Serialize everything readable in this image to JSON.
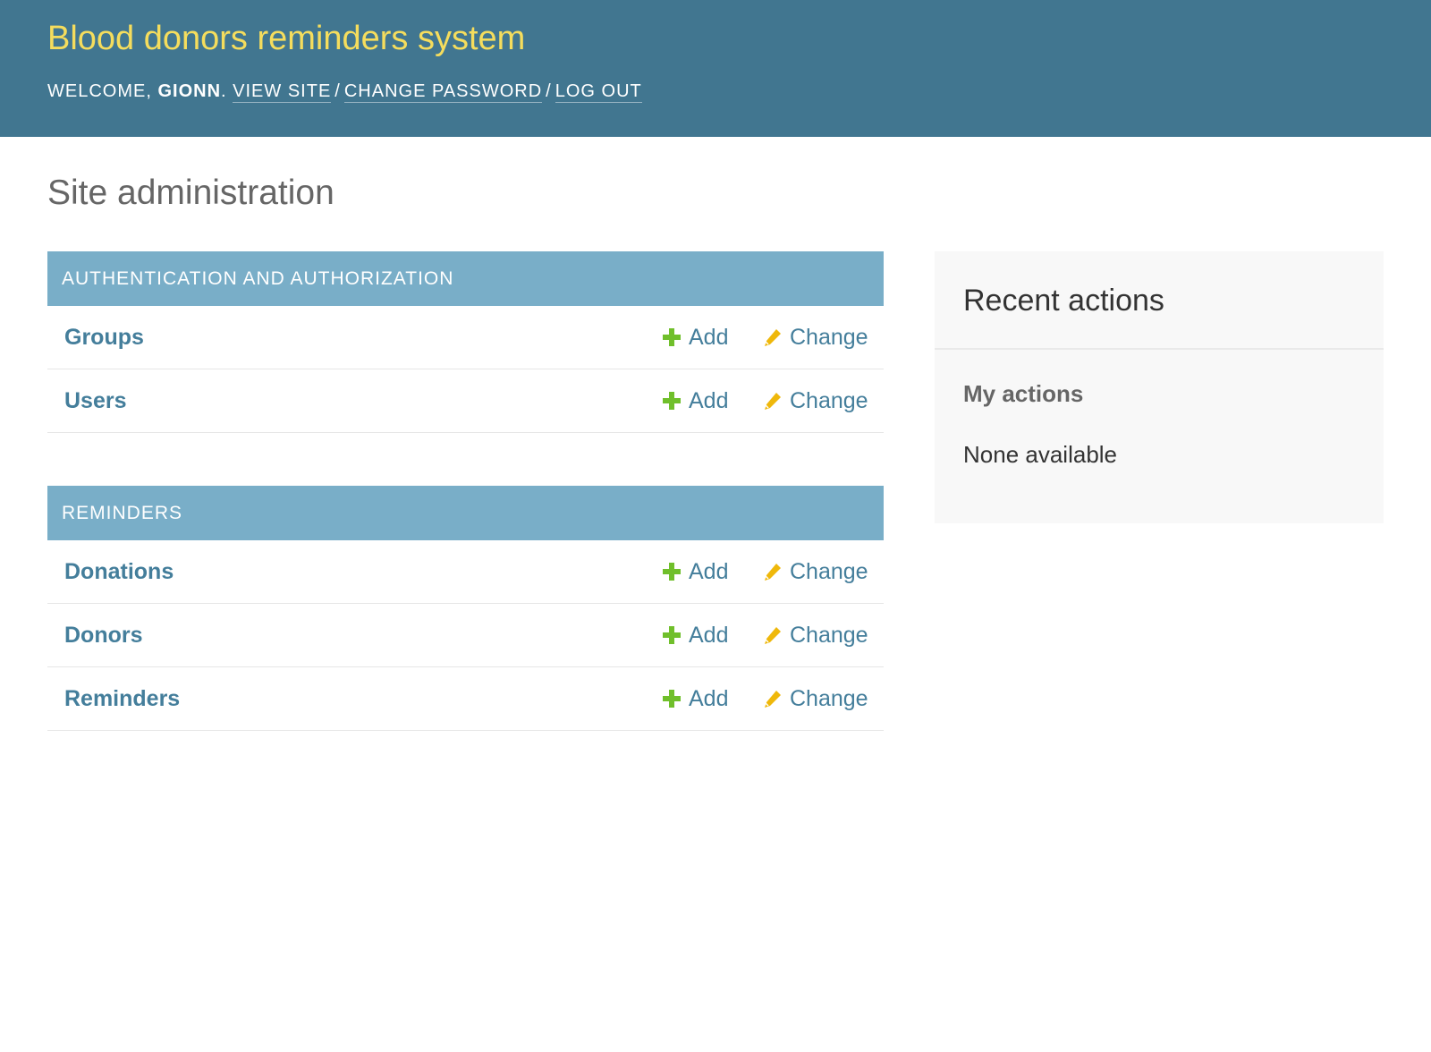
{
  "header": {
    "branding": "Blood donors reminders system",
    "welcome_prefix": "Welcome,",
    "username": "gionn",
    "view_site": "View site",
    "change_password": "Change password",
    "log_out": "Log out"
  },
  "page": {
    "title": "Site administration"
  },
  "modules": [
    {
      "caption": "Authentication and Authorization",
      "models": [
        {
          "name": "Groups",
          "add": "Add",
          "change": "Change"
        },
        {
          "name": "Users",
          "add": "Add",
          "change": "Change"
        }
      ]
    },
    {
      "caption": "Reminders",
      "models": [
        {
          "name": "Donations",
          "add": "Add",
          "change": "Change"
        },
        {
          "name": "Donors",
          "add": "Add",
          "change": "Change"
        },
        {
          "name": "Reminders",
          "add": "Add",
          "change": "Change"
        }
      ]
    }
  ],
  "recent_actions": {
    "title": "Recent actions",
    "my_actions": "My actions",
    "empty": "None available"
  },
  "colors": {
    "header_bg": "#417690",
    "branding": "#f5dd5d",
    "module_caption_bg": "#79aec8",
    "link": "#447e9b",
    "add_icon": "#70bf2b",
    "change_icon": "#efb80b"
  },
  "icons": {
    "add": "plus-icon",
    "change": "pencil-icon"
  }
}
